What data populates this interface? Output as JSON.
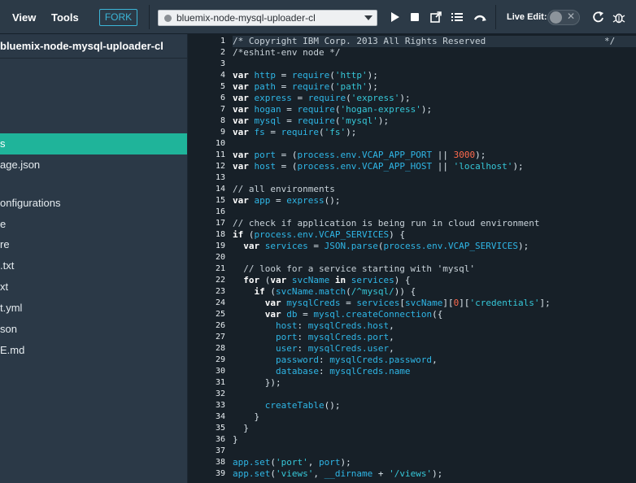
{
  "toolbar": {
    "menu": [
      "View",
      "Tools"
    ],
    "fork_label": "FORK",
    "project_name": "bluemix-node-mysql-uploader-cl",
    "live_edit_label": "Live Edit:",
    "toggle_state": "off",
    "accent_color": "#3cb6d8"
  },
  "sidebar": {
    "project_title": "bluemix-node-mysql-uploader-cl",
    "items": [
      {
        "label": "s",
        "active": true
      },
      {
        "label": "age.json"
      },
      {
        "label": "onfigurations"
      },
      {
        "label": "e"
      },
      {
        "label": "re"
      },
      {
        "label": ".txt"
      },
      {
        "label": "xt"
      },
      {
        "label": "t.yml"
      },
      {
        "label": "son"
      },
      {
        "label": "E.md"
      }
    ],
    "active_color": "#1fb49a"
  },
  "editor": {
    "line_numbers": [
      "1",
      "2",
      "3",
      "4",
      "5",
      "6",
      "7",
      "8",
      "9",
      "10",
      "11",
      "12",
      "13",
      "14",
      "15",
      "16",
      "17",
      "18",
      "19",
      "20",
      "21",
      "22",
      "23",
      "24",
      "25",
      "26",
      "27",
      "28",
      "29",
      "30",
      "31",
      "32",
      "33",
      "34",
      "35",
      "36",
      "37",
      "38",
      "39"
    ],
    "lines": [
      [
        [
          "cm",
          "/* Copyright IBM Corp. 2013 All Rights Reserved                      */"
        ]
      ],
      [
        [
          "cm",
          "/*eshint-env node */"
        ]
      ],
      [],
      [
        [
          "kw",
          "var"
        ],
        [
          "pl",
          " "
        ],
        [
          "var",
          "http"
        ],
        [
          "pl",
          " = "
        ],
        [
          "var",
          "require"
        ],
        [
          "pl",
          "("
        ],
        [
          "str",
          "'http'"
        ],
        [
          "pl",
          ");"
        ]
      ],
      [
        [
          "kw",
          "var"
        ],
        [
          "pl",
          " "
        ],
        [
          "var",
          "path"
        ],
        [
          "pl",
          " = "
        ],
        [
          "var",
          "require"
        ],
        [
          "pl",
          "("
        ],
        [
          "str",
          "'path'"
        ],
        [
          "pl",
          ");"
        ]
      ],
      [
        [
          "kw",
          "var"
        ],
        [
          "pl",
          " "
        ],
        [
          "var",
          "express"
        ],
        [
          "pl",
          " = "
        ],
        [
          "var",
          "require"
        ],
        [
          "pl",
          "("
        ],
        [
          "str",
          "'express'"
        ],
        [
          "pl",
          ");"
        ]
      ],
      [
        [
          "kw",
          "var"
        ],
        [
          "pl",
          " "
        ],
        [
          "var",
          "hogan"
        ],
        [
          "pl",
          " = "
        ],
        [
          "var",
          "require"
        ],
        [
          "pl",
          "("
        ],
        [
          "str",
          "'hogan-express'"
        ],
        [
          "pl",
          ");"
        ]
      ],
      [
        [
          "kw",
          "var"
        ],
        [
          "pl",
          " "
        ],
        [
          "var",
          "mysql"
        ],
        [
          "pl",
          " = "
        ],
        [
          "var",
          "require"
        ],
        [
          "pl",
          "("
        ],
        [
          "str",
          "'mysql'"
        ],
        [
          "pl",
          ");"
        ]
      ],
      [
        [
          "kw",
          "var"
        ],
        [
          "pl",
          " "
        ],
        [
          "var",
          "fs"
        ],
        [
          "pl",
          " = "
        ],
        [
          "var",
          "require"
        ],
        [
          "pl",
          "("
        ],
        [
          "str",
          "'fs'"
        ],
        [
          "pl",
          ");"
        ]
      ],
      [],
      [
        [
          "kw",
          "var"
        ],
        [
          "pl",
          " "
        ],
        [
          "var",
          "port"
        ],
        [
          "pl",
          " = ("
        ],
        [
          "var",
          "process.env.VCAP_APP_PORT"
        ],
        [
          "pl",
          " || "
        ],
        [
          "num",
          "3000"
        ],
        [
          "pl",
          ");"
        ]
      ],
      [
        [
          "kw",
          "var"
        ],
        [
          "pl",
          " "
        ],
        [
          "var",
          "host"
        ],
        [
          "pl",
          " = ("
        ],
        [
          "var",
          "process.env.VCAP_APP_HOST"
        ],
        [
          "pl",
          " || "
        ],
        [
          "str",
          "'localhost'"
        ],
        [
          "pl",
          ");"
        ]
      ],
      [],
      [
        [
          "cm",
          "// all environments"
        ]
      ],
      [
        [
          "kw",
          "var"
        ],
        [
          "pl",
          " "
        ],
        [
          "var",
          "app"
        ],
        [
          "pl",
          " = "
        ],
        [
          "var",
          "express"
        ],
        [
          "pl",
          "();"
        ]
      ],
      [],
      [
        [
          "cm",
          "// check if application is being run in cloud environment"
        ]
      ],
      [
        [
          "kw",
          "if"
        ],
        [
          "pl",
          " ("
        ],
        [
          "var",
          "process.env.VCAP_SERVICES"
        ],
        [
          "pl",
          ") {"
        ]
      ],
      [
        [
          "pl",
          "  "
        ],
        [
          "kw",
          "var"
        ],
        [
          "pl",
          " "
        ],
        [
          "var",
          "services"
        ],
        [
          "pl",
          " = "
        ],
        [
          "var",
          "JSON.parse"
        ],
        [
          "pl",
          "("
        ],
        [
          "var",
          "process.env.VCAP_SERVICES"
        ],
        [
          "pl",
          ");"
        ]
      ],
      [],
      [
        [
          "cm",
          "  // look for a service starting with 'mysql'"
        ]
      ],
      [
        [
          "pl",
          "  "
        ],
        [
          "kw",
          "for"
        ],
        [
          "pl",
          " ("
        ],
        [
          "kw",
          "var"
        ],
        [
          "pl",
          " "
        ],
        [
          "var",
          "svcName"
        ],
        [
          "pl",
          " "
        ],
        [
          "kw",
          "in"
        ],
        [
          "pl",
          " "
        ],
        [
          "var",
          "services"
        ],
        [
          "pl",
          ") {"
        ]
      ],
      [
        [
          "pl",
          "    "
        ],
        [
          "kw",
          "if"
        ],
        [
          "pl",
          " ("
        ],
        [
          "var",
          "svcName.match"
        ],
        [
          "pl",
          "("
        ],
        [
          "str",
          "/^mysql/"
        ],
        [
          "pl",
          ")) {"
        ]
      ],
      [
        [
          "pl",
          "      "
        ],
        [
          "kw",
          "var"
        ],
        [
          "pl",
          " "
        ],
        [
          "var",
          "mysqlCreds"
        ],
        [
          "pl",
          " = "
        ],
        [
          "var",
          "services"
        ],
        [
          "pl",
          "["
        ],
        [
          "var",
          "svcName"
        ],
        [
          "pl",
          "]["
        ],
        [
          "num",
          "0"
        ],
        [
          "pl",
          "]["
        ],
        [
          "str",
          "'credentials'"
        ],
        [
          "pl",
          "];"
        ]
      ],
      [
        [
          "pl",
          "      "
        ],
        [
          "kw",
          "var"
        ],
        [
          "pl",
          " "
        ],
        [
          "var",
          "db"
        ],
        [
          "pl",
          " = "
        ],
        [
          "var",
          "mysql.createConnection"
        ],
        [
          "pl",
          "({"
        ]
      ],
      [
        [
          "pl",
          "        "
        ],
        [
          "var",
          "host"
        ],
        [
          "pl",
          ": "
        ],
        [
          "var",
          "mysqlCreds.host"
        ],
        [
          "pl",
          ","
        ]
      ],
      [
        [
          "pl",
          "        "
        ],
        [
          "var",
          "port"
        ],
        [
          "pl",
          ": "
        ],
        [
          "var",
          "mysqlCreds.port"
        ],
        [
          "pl",
          ","
        ]
      ],
      [
        [
          "pl",
          "        "
        ],
        [
          "var",
          "user"
        ],
        [
          "pl",
          ": "
        ],
        [
          "var",
          "mysqlCreds.user"
        ],
        [
          "pl",
          ","
        ]
      ],
      [
        [
          "pl",
          "        "
        ],
        [
          "var",
          "password"
        ],
        [
          "pl",
          ": "
        ],
        [
          "var",
          "mysqlCreds.password"
        ],
        [
          "pl",
          ","
        ]
      ],
      [
        [
          "pl",
          "        "
        ],
        [
          "var",
          "database"
        ],
        [
          "pl",
          ": "
        ],
        [
          "var",
          "mysqlCreds.name"
        ]
      ],
      [
        [
          "pl",
          "      });"
        ]
      ],
      [],
      [
        [
          "pl",
          "      "
        ],
        [
          "var",
          "createTable"
        ],
        [
          "pl",
          "();"
        ]
      ],
      [
        [
          "pl",
          "    }"
        ]
      ],
      [
        [
          "pl",
          "  }"
        ]
      ],
      [
        [
          "pl",
          "}"
        ]
      ],
      [],
      [
        [
          "var",
          "app.set"
        ],
        [
          "pl",
          "("
        ],
        [
          "str",
          "'port'"
        ],
        [
          "pl",
          ", "
        ],
        [
          "var",
          "port"
        ],
        [
          "pl",
          ");"
        ]
      ],
      [
        [
          "var",
          "app.set"
        ],
        [
          "pl",
          "("
        ],
        [
          "str",
          "'views'"
        ],
        [
          "pl",
          ", "
        ],
        [
          "var",
          "__dirname"
        ],
        [
          "pl",
          " + "
        ],
        [
          "str",
          "'/views'"
        ],
        [
          "pl",
          ");"
        ]
      ]
    ]
  }
}
